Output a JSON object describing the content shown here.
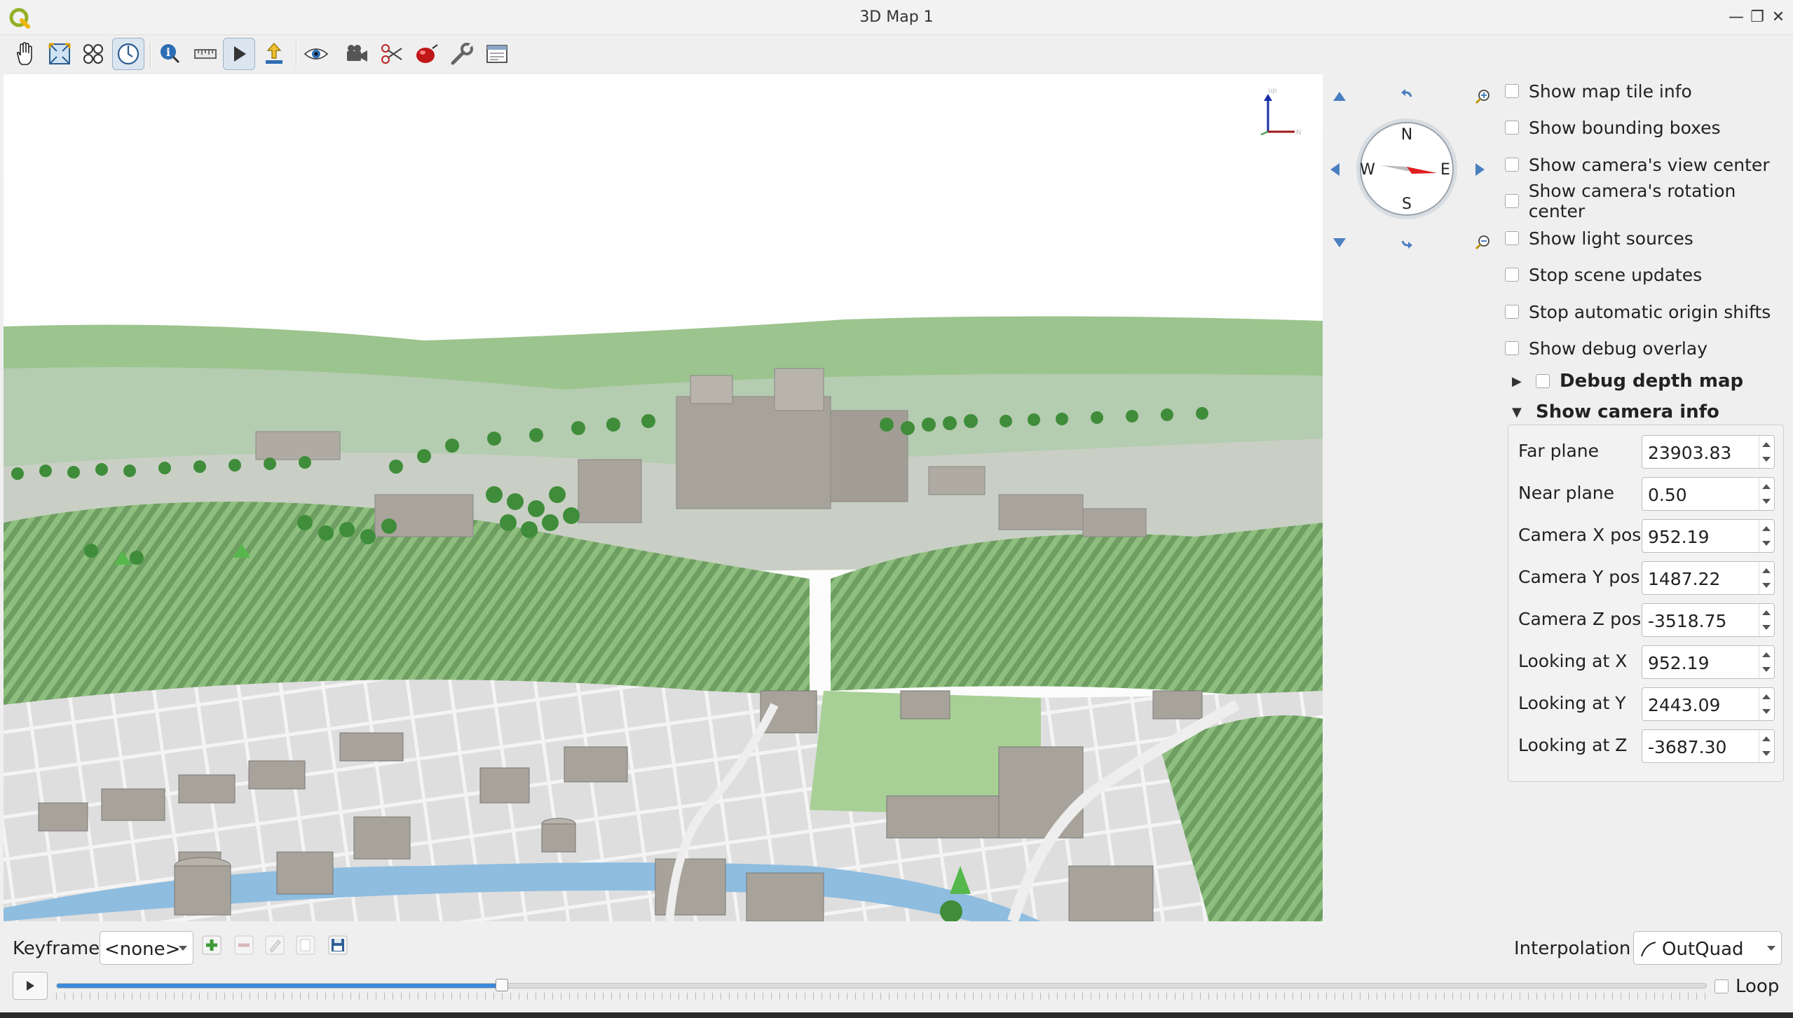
{
  "window": {
    "title": "3D Map 1",
    "minimize": "—",
    "restore": "❐",
    "close": "✕"
  },
  "toolbar": {
    "tools": [
      {
        "name": "pan-icon"
      },
      {
        "name": "zoom-full-icon"
      },
      {
        "name": "identify-features-icon"
      },
      {
        "name": "camera-control-icon",
        "active": true
      },
      {
        "name": "identify-icon"
      },
      {
        "name": "measure-icon"
      },
      {
        "name": "animation-play-icon"
      },
      {
        "name": "export-icon"
      },
      {
        "name": "visibility-icon"
      },
      {
        "name": "camera-icon"
      },
      {
        "name": "cross-section-icon"
      },
      {
        "name": "effects-icon"
      },
      {
        "name": "configure-icon"
      },
      {
        "name": "dock-icon"
      }
    ]
  },
  "viewport": {
    "axis_up_label": "up",
    "axis_north_label": "N"
  },
  "compass": {
    "north": "N",
    "south": "S",
    "east": "E",
    "west": "W"
  },
  "debug": {
    "options": [
      {
        "label": "Show map tile info",
        "checked": false
      },
      {
        "label": "Show bounding boxes",
        "checked": false
      },
      {
        "label": "Show camera's view center",
        "checked": false
      },
      {
        "label": "Show camera's rotation center",
        "checked": false
      },
      {
        "label": "Show light sources",
        "checked": false
      },
      {
        "label": "Stop scene updates",
        "checked": false
      },
      {
        "label": "Stop automatic origin shifts",
        "checked": false
      },
      {
        "label": "Show debug overlay",
        "checked": false
      }
    ],
    "depth_map_group": {
      "label": "Debug depth map",
      "expanded": false,
      "checked": false
    },
    "camera_group": {
      "label": "Show camera info",
      "expanded": true
    }
  },
  "camera_info": {
    "far_plane": {
      "label": "Far plane",
      "value": "23903.83"
    },
    "near_plane": {
      "label": "Near plane",
      "value": "0.50"
    },
    "camera_x": {
      "label": "Camera X pos",
      "value": "952.19"
    },
    "camera_y": {
      "label": "Camera Y pos",
      "value": "1487.22"
    },
    "camera_z": {
      "label": "Camera Z pos",
      "value": "-3518.75"
    },
    "look_x": {
      "label": "Looking at X",
      "value": "952.19"
    },
    "look_y": {
      "label": "Looking at Y",
      "value": "2443.09"
    },
    "look_z": {
      "label": "Looking at Z",
      "value": "-3687.30"
    }
  },
  "animation": {
    "keyframe_label": "Keyframe",
    "keyframe_value": "<none>",
    "interpolation_label": "Interpolation",
    "interpolation_value": "OutQuad",
    "timeline_position": 0.27,
    "loop_label": "Loop",
    "loop_checked": false
  },
  "colors": {
    "accent": "#3d8ad8",
    "grass": "#8fc27f",
    "building": "#a8a39a",
    "river": "#8ebde0",
    "compass_needle": "#e02020"
  }
}
